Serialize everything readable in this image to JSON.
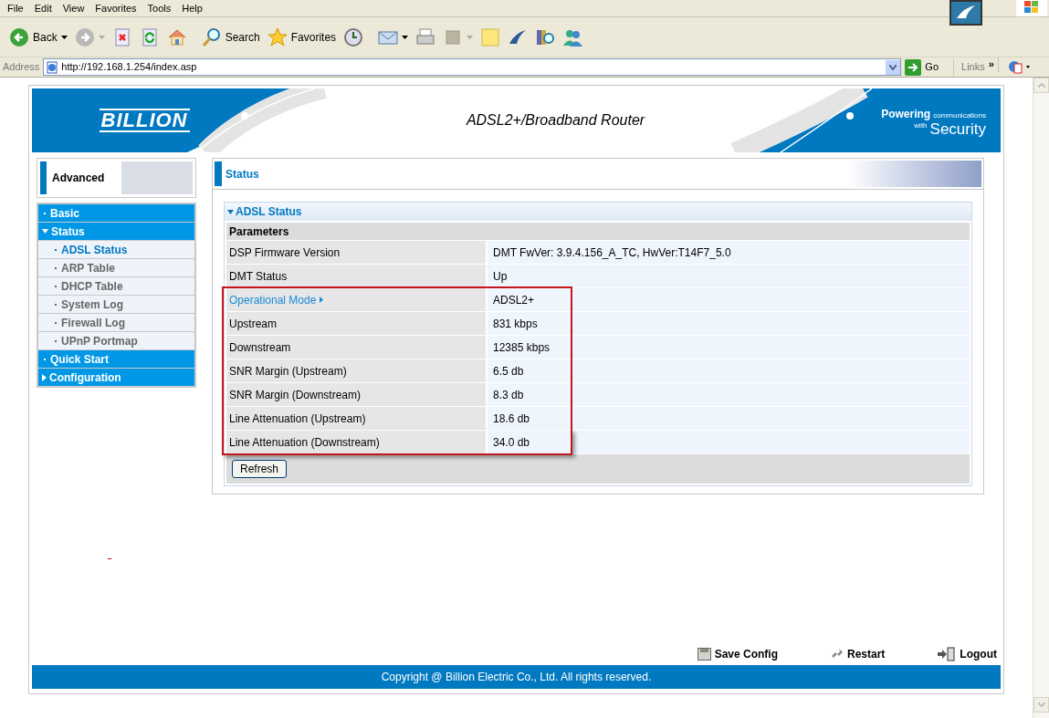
{
  "browser": {
    "menu": [
      "File",
      "Edit",
      "View",
      "Favorites",
      "Tools",
      "Help"
    ],
    "toolbar": [
      {
        "kind": "back",
        "label": "Back",
        "dropdown": true
      },
      {
        "kind": "forward",
        "dropdown": true
      },
      {
        "kind": "stop"
      },
      {
        "kind": "refresh"
      },
      {
        "kind": "home"
      },
      {
        "kind": "search",
        "label": "Search"
      },
      {
        "kind": "favorites",
        "label": "Favorites"
      },
      {
        "kind": "history"
      },
      {
        "kind": "mail",
        "dropdown": true
      },
      {
        "kind": "print"
      },
      {
        "kind": "edit",
        "dropdown": true
      },
      {
        "kind": "note"
      },
      {
        "kind": "messenger"
      },
      {
        "kind": "research"
      },
      {
        "kind": "contacts"
      }
    ],
    "address_label": "Address",
    "url": "http://192.168.1.254/index.asp",
    "go": "Go",
    "links": "Links",
    "links_more": "»"
  },
  "banner": {
    "logo": "BILLION",
    "title": "ADSL2+/Broadband Router",
    "tagline": [
      "Powering",
      "communications",
      "with",
      "Security"
    ]
  },
  "sidebar": {
    "heading": "Advanced",
    "items": [
      {
        "label": "Basic",
        "kind": "link"
      },
      {
        "label": "Status",
        "kind": "folder",
        "expanded": true,
        "children": [
          {
            "label": "ADSL Status",
            "selected": true
          },
          {
            "label": "ARP Table",
            "selected": false
          },
          {
            "label": "DHCP Table",
            "selected": false
          },
          {
            "label": "System Log",
            "selected": false
          },
          {
            "label": "Firewall Log",
            "selected": false
          },
          {
            "label": "UPnP Portmap",
            "selected": false
          }
        ]
      },
      {
        "label": "Quick Start",
        "kind": "link"
      },
      {
        "label": "Configuration",
        "kind": "folder",
        "expanded": false
      }
    ]
  },
  "main": {
    "title": "Status",
    "section": "ADSL Status",
    "table_header": "Parameters",
    "rows": [
      {
        "label": "DSP Firmware Version",
        "value": "DMT FwVer: 3.9.4.156_A_TC, HwVer:T14F7_5.0",
        "link": false,
        "highlighted": false
      },
      {
        "label": "DMT Status",
        "value": "Up",
        "link": false,
        "highlighted": false
      },
      {
        "label": "Operational Mode",
        "value": "ADSL2+",
        "link": true,
        "highlighted": true
      },
      {
        "label": "Upstream",
        "value": "831 kbps",
        "link": false,
        "highlighted": true
      },
      {
        "label": "Downstream",
        "value": "12385 kbps",
        "link": false,
        "highlighted": true
      },
      {
        "label": "SNR Margin (Upstream)",
        "value": "6.5 db",
        "link": false,
        "highlighted": true
      },
      {
        "label": "SNR Margin (Downstream)",
        "value": "8.3 db",
        "link": false,
        "highlighted": true
      },
      {
        "label": "Line Attenuation (Upstream)",
        "value": "18.6 db",
        "link": false,
        "highlighted": true
      },
      {
        "label": "Line Attenuation (Downstream)",
        "value": "34.0 db",
        "link": false,
        "highlighted": true
      }
    ],
    "button": "Refresh"
  },
  "footer": {
    "actions": [
      {
        "kind": "save",
        "label": "Save Config"
      },
      {
        "kind": "restart",
        "label": "Restart"
      },
      {
        "kind": "logout",
        "label": "Logout"
      }
    ],
    "copyright": "Copyright @ Billion Electric Co., Ltd. All rights reserved."
  }
}
